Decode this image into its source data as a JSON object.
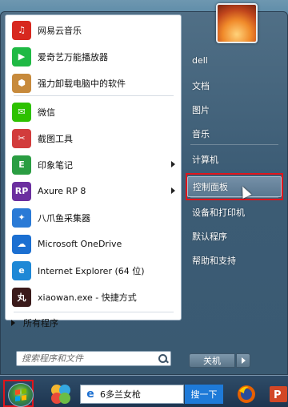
{
  "start_menu": {
    "programs": [
      {
        "label": "网易云音乐",
        "icon": "netease-music-icon",
        "color": "#d7281f",
        "glyph": "♫",
        "arrow": false
      },
      {
        "label": "爱奇艺万能播放器",
        "icon": "iqiyi-player-icon",
        "color": "#1fb944",
        "glyph": "▶",
        "arrow": false
      },
      {
        "label": "强力卸载电脑中的软件",
        "icon": "uninstall-tool-icon",
        "color": "#c78a3c",
        "glyph": "⬢",
        "arrow": false
      },
      {
        "label": "微信",
        "icon": "wechat-icon",
        "color": "#2dc100",
        "glyph": "✉",
        "arrow": false
      },
      {
        "label": "截图工具",
        "icon": "snipping-tool-icon",
        "color": "#d23c3c",
        "glyph": "✂",
        "arrow": false
      },
      {
        "label": "印象笔记",
        "icon": "evernote-icon",
        "color": "#2a9d42",
        "glyph": "E",
        "arrow": true
      },
      {
        "label": "Axure RP 8",
        "icon": "axure-icon",
        "color": "#6b2f9f",
        "glyph": "RP",
        "arrow": true
      },
      {
        "label": "八爪鱼采集器",
        "icon": "octopus-collector-icon",
        "color": "#2a7ad6",
        "glyph": "✦",
        "arrow": false
      },
      {
        "label": "Microsoft OneDrive",
        "icon": "onedrive-icon",
        "color": "#1b6fd1",
        "glyph": "☁",
        "arrow": false
      },
      {
        "label": "Internet Explorer (64 位)",
        "icon": "internet-explorer-icon",
        "color": "#1e88d6",
        "glyph": "e",
        "arrow": false
      },
      {
        "label": "xiaowan.exe - 快捷方式",
        "icon": "xiaowan-icon",
        "color": "#3a1a1a",
        "glyph": "丸",
        "arrow": false
      }
    ],
    "all_programs_label": "所有程序",
    "search_placeholder": "搜索程序和文件",
    "right_items": [
      {
        "label": "dell",
        "highlight": false
      },
      {
        "label": "文档",
        "highlight": false
      },
      {
        "label": "图片",
        "highlight": false
      },
      {
        "label": "音乐",
        "highlight": false
      },
      {
        "label": "计算机",
        "highlight": false
      },
      {
        "label": "控制面板",
        "highlight": true
      },
      {
        "label": "设备和打印机",
        "highlight": false
      },
      {
        "label": "默认程序",
        "highlight": false
      },
      {
        "label": "帮助和支持",
        "highlight": false
      }
    ],
    "shutdown_label": "关机"
  },
  "taskbar": {
    "search_query": "6多兰女枪",
    "search_button_label": "搜一下"
  },
  "colors": {
    "highlight_border": "#e0151b",
    "menu_bg": "#3c5c75"
  }
}
